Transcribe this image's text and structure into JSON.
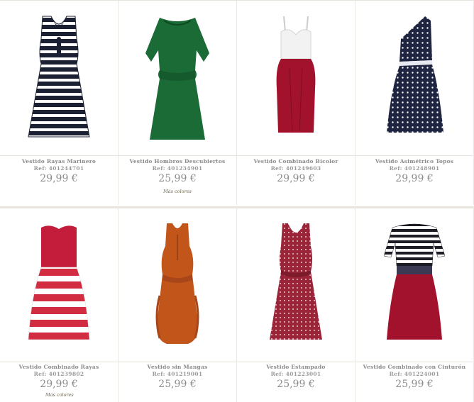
{
  "products": [
    {
      "name": "Vestido Rayas Marinero",
      "ref": "Ref: 401244701",
      "price": "29,99 €",
      "more": ""
    },
    {
      "name": "Vestido Hombros Descubiertos",
      "ref": "Ref: 401234901",
      "price": "25,99 €",
      "more": "Más colores"
    },
    {
      "name": "Vestido Combinado Bicolor",
      "ref": "Ref: 401249603",
      "price": "29,99 €",
      "more": ""
    },
    {
      "name": "Vestido Asimétrico Topos",
      "ref": "Ref: 401248901",
      "price": "29,99 €",
      "more": ""
    },
    {
      "name": "Vestido Combinado Rayas",
      "ref": "Ref: 401239802",
      "price": "29,99 €",
      "more": "Más colores"
    },
    {
      "name": "Vestido sin Mangas",
      "ref": "Ref: 401219001",
      "price": "25,99 €",
      "more": ""
    },
    {
      "name": "Vestido Estampado",
      "ref": "Ref: 401223001",
      "price": "25,99 €",
      "more": ""
    },
    {
      "name": "Vestido Combinado con Cinturón",
      "ref": "Ref: 401224001",
      "price": "25,99 €",
      "more": ""
    }
  ],
  "colors": {
    "navy": "#1c2033",
    "green": "#1a6b35",
    "red": "#a3122d",
    "orange": "#c2551a",
    "print_red": "#9a2438",
    "border": "#e6e3dc"
  }
}
